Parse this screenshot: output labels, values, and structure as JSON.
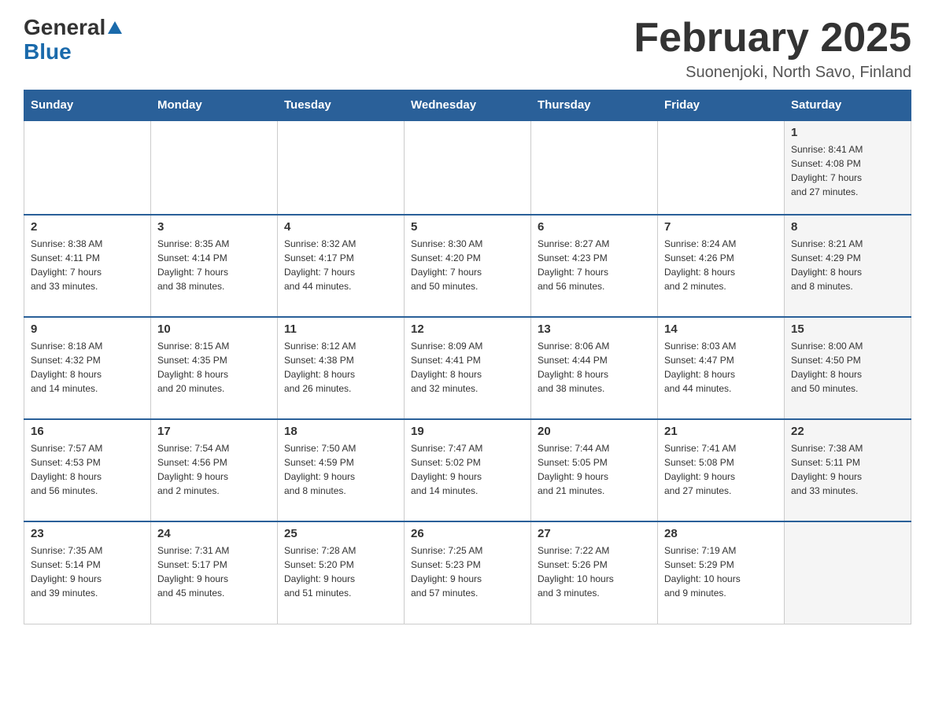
{
  "logo": {
    "general": "General",
    "blue": "Blue"
  },
  "title": "February 2025",
  "subtitle": "Suonenjoki, North Savo, Finland",
  "weekdays": [
    "Sunday",
    "Monday",
    "Tuesday",
    "Wednesday",
    "Thursday",
    "Friday",
    "Saturday"
  ],
  "weeks": [
    [
      {
        "day": "",
        "info": ""
      },
      {
        "day": "",
        "info": ""
      },
      {
        "day": "",
        "info": ""
      },
      {
        "day": "",
        "info": ""
      },
      {
        "day": "",
        "info": ""
      },
      {
        "day": "",
        "info": ""
      },
      {
        "day": "1",
        "info": "Sunrise: 8:41 AM\nSunset: 4:08 PM\nDaylight: 7 hours\nand 27 minutes."
      }
    ],
    [
      {
        "day": "2",
        "info": "Sunrise: 8:38 AM\nSunset: 4:11 PM\nDaylight: 7 hours\nand 33 minutes."
      },
      {
        "day": "3",
        "info": "Sunrise: 8:35 AM\nSunset: 4:14 PM\nDaylight: 7 hours\nand 38 minutes."
      },
      {
        "day": "4",
        "info": "Sunrise: 8:32 AM\nSunset: 4:17 PM\nDaylight: 7 hours\nand 44 minutes."
      },
      {
        "day": "5",
        "info": "Sunrise: 8:30 AM\nSunset: 4:20 PM\nDaylight: 7 hours\nand 50 minutes."
      },
      {
        "day": "6",
        "info": "Sunrise: 8:27 AM\nSunset: 4:23 PM\nDaylight: 7 hours\nand 56 minutes."
      },
      {
        "day": "7",
        "info": "Sunrise: 8:24 AM\nSunset: 4:26 PM\nDaylight: 8 hours\nand 2 minutes."
      },
      {
        "day": "8",
        "info": "Sunrise: 8:21 AM\nSunset: 4:29 PM\nDaylight: 8 hours\nand 8 minutes."
      }
    ],
    [
      {
        "day": "9",
        "info": "Sunrise: 8:18 AM\nSunset: 4:32 PM\nDaylight: 8 hours\nand 14 minutes."
      },
      {
        "day": "10",
        "info": "Sunrise: 8:15 AM\nSunset: 4:35 PM\nDaylight: 8 hours\nand 20 minutes."
      },
      {
        "day": "11",
        "info": "Sunrise: 8:12 AM\nSunset: 4:38 PM\nDaylight: 8 hours\nand 26 minutes."
      },
      {
        "day": "12",
        "info": "Sunrise: 8:09 AM\nSunset: 4:41 PM\nDaylight: 8 hours\nand 32 minutes."
      },
      {
        "day": "13",
        "info": "Sunrise: 8:06 AM\nSunset: 4:44 PM\nDaylight: 8 hours\nand 38 minutes."
      },
      {
        "day": "14",
        "info": "Sunrise: 8:03 AM\nSunset: 4:47 PM\nDaylight: 8 hours\nand 44 minutes."
      },
      {
        "day": "15",
        "info": "Sunrise: 8:00 AM\nSunset: 4:50 PM\nDaylight: 8 hours\nand 50 minutes."
      }
    ],
    [
      {
        "day": "16",
        "info": "Sunrise: 7:57 AM\nSunset: 4:53 PM\nDaylight: 8 hours\nand 56 minutes."
      },
      {
        "day": "17",
        "info": "Sunrise: 7:54 AM\nSunset: 4:56 PM\nDaylight: 9 hours\nand 2 minutes."
      },
      {
        "day": "18",
        "info": "Sunrise: 7:50 AM\nSunset: 4:59 PM\nDaylight: 9 hours\nand 8 minutes."
      },
      {
        "day": "19",
        "info": "Sunrise: 7:47 AM\nSunset: 5:02 PM\nDaylight: 9 hours\nand 14 minutes."
      },
      {
        "day": "20",
        "info": "Sunrise: 7:44 AM\nSunset: 5:05 PM\nDaylight: 9 hours\nand 21 minutes."
      },
      {
        "day": "21",
        "info": "Sunrise: 7:41 AM\nSunset: 5:08 PM\nDaylight: 9 hours\nand 27 minutes."
      },
      {
        "day": "22",
        "info": "Sunrise: 7:38 AM\nSunset: 5:11 PM\nDaylight: 9 hours\nand 33 minutes."
      }
    ],
    [
      {
        "day": "23",
        "info": "Sunrise: 7:35 AM\nSunset: 5:14 PM\nDaylight: 9 hours\nand 39 minutes."
      },
      {
        "day": "24",
        "info": "Sunrise: 7:31 AM\nSunset: 5:17 PM\nDaylight: 9 hours\nand 45 minutes."
      },
      {
        "day": "25",
        "info": "Sunrise: 7:28 AM\nSunset: 5:20 PM\nDaylight: 9 hours\nand 51 minutes."
      },
      {
        "day": "26",
        "info": "Sunrise: 7:25 AM\nSunset: 5:23 PM\nDaylight: 9 hours\nand 57 minutes."
      },
      {
        "day": "27",
        "info": "Sunrise: 7:22 AM\nSunset: 5:26 PM\nDaylight: 10 hours\nand 3 minutes."
      },
      {
        "day": "28",
        "info": "Sunrise: 7:19 AM\nSunset: 5:29 PM\nDaylight: 10 hours\nand 9 minutes."
      },
      {
        "day": "",
        "info": ""
      }
    ]
  ]
}
